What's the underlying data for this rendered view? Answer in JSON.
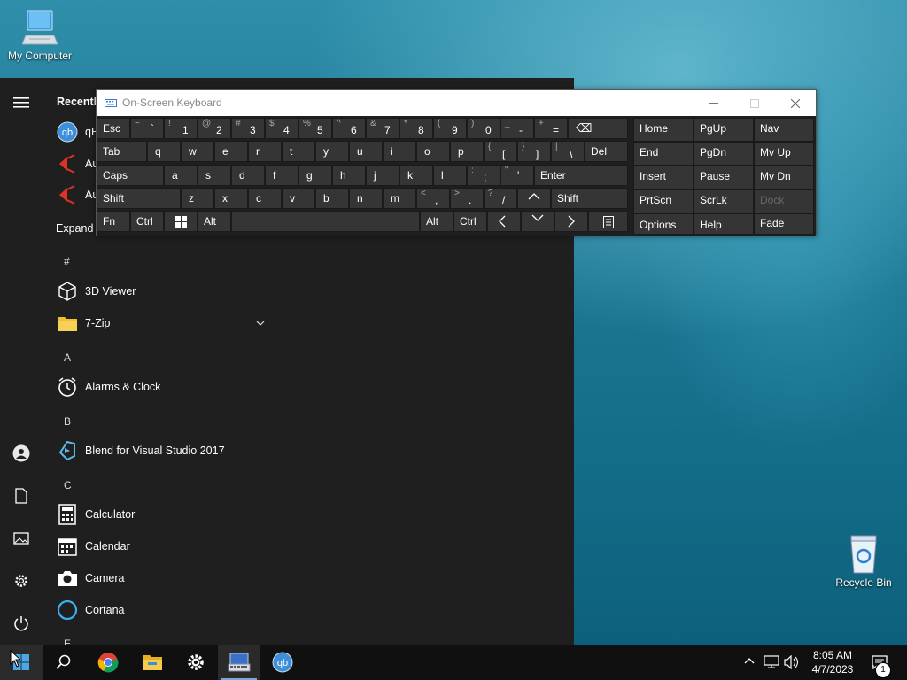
{
  "desktop": {
    "my_computer": "My Computer",
    "recycle_bin": "Recycle Bin"
  },
  "start_menu": {
    "recently_added": "Recently",
    "recent_items": [
      "qB",
      "Au",
      "Au"
    ],
    "expand": "Expand",
    "sections": {
      "hash": "#",
      "a": "A",
      "b": "B",
      "c": "C",
      "e": "E"
    },
    "apps": {
      "viewer3d": "3D Viewer",
      "zip7": "7-Zip",
      "alarms": "Alarms & Clock",
      "blend": "Blend for Visual Studio 2017",
      "calculator": "Calculator",
      "calendar": "Calendar",
      "camera": "Camera",
      "cortana": "Cortana"
    }
  },
  "osk": {
    "title": "On-Screen Keyboard",
    "row1": [
      {
        "main": "Esc"
      },
      {
        "shift": "~",
        "main": "`"
      },
      {
        "shift": "!",
        "main": "1"
      },
      {
        "shift": "@",
        "main": "2"
      },
      {
        "shift": "#",
        "main": "3"
      },
      {
        "shift": "$",
        "main": "4"
      },
      {
        "shift": "%",
        "main": "5"
      },
      {
        "shift": "^",
        "main": "6"
      },
      {
        "shift": "&",
        "main": "7"
      },
      {
        "shift": "*",
        "main": "8"
      },
      {
        "shift": "(",
        "main": "9"
      },
      {
        "shift": ")",
        "main": "0"
      },
      {
        "shift": "_",
        "main": "-"
      },
      {
        "shift": "+",
        "main": "="
      },
      {
        "main": "⌫"
      }
    ],
    "row2": [
      "Tab",
      "q",
      "w",
      "e",
      "r",
      "t",
      "y",
      "u",
      "i",
      "o",
      "p",
      "[",
      "]",
      "\\",
      "Del"
    ],
    "row2_shift": {
      "lbrace": "{",
      "rbrace": "}",
      "pipe": "|"
    },
    "row3": [
      "Caps",
      "a",
      "s",
      "d",
      "f",
      "g",
      "h",
      "j",
      "k",
      "l",
      ";",
      "'",
      "Enter"
    ],
    "row3_shift": {
      "colon": ":",
      "quote": "\""
    },
    "row4": [
      "Shift",
      "z",
      "x",
      "c",
      "v",
      "b",
      "n",
      "m",
      ",",
      ".",
      "/",
      "^",
      "Shift"
    ],
    "row4_shift": {
      "lt": "<",
      "gt": ">",
      "q": "?"
    },
    "row5": [
      "Fn",
      "Ctrl",
      "Alt",
      "Alt",
      "Ctrl"
    ],
    "nav": [
      [
        "Home",
        "PgUp",
        "Nav"
      ],
      [
        "End",
        "PgDn",
        "Mv Up"
      ],
      [
        "Insert",
        "Pause",
        "Mv Dn"
      ],
      [
        "PrtScn",
        "ScrLk",
        "Dock"
      ],
      [
        "Options",
        "Help",
        "Fade"
      ]
    ]
  },
  "taskbar": {
    "time": "8:05 AM",
    "date": "4/7/2023",
    "notification_count": "1"
  },
  "colors": {
    "accent": "#0078d7",
    "key_bg": "#353535",
    "menu_bg": "#1f1f1f"
  }
}
